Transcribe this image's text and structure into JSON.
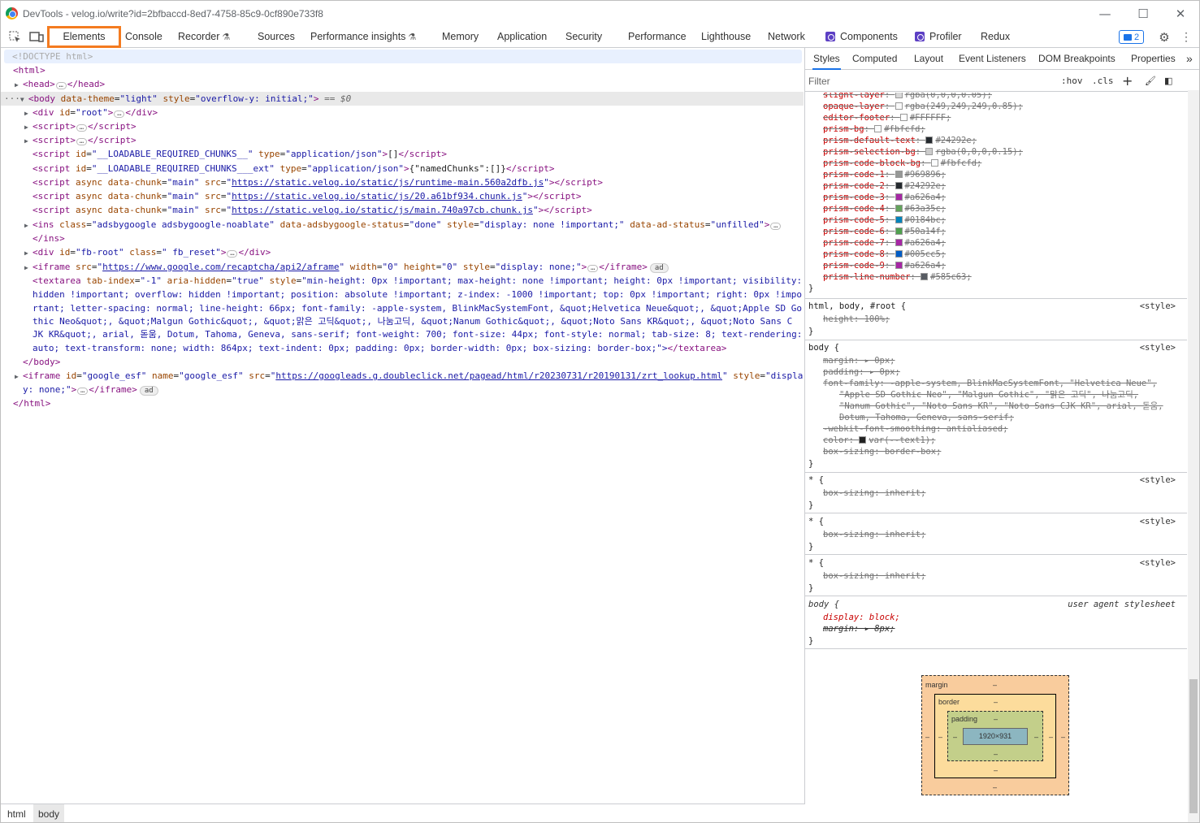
{
  "window": {
    "title": "DevTools - velog.io/write?id=2bfbaccd-8ed7-4758-85c9-0cf890e733f8",
    "minimize": "—",
    "maximize": "☐",
    "close": "✕"
  },
  "tabs": {
    "elements": "Elements",
    "console": "Console",
    "recorder": "Recorder",
    "sources": "Sources",
    "performance_insights": "Performance insights",
    "memory": "Memory",
    "application": "Application",
    "security": "Security",
    "performance": "Performance",
    "lighthouse": "Lighthouse",
    "network": "Network",
    "components": "Components",
    "profiler": "Profiler",
    "redux": "Redux",
    "issues_count": "2"
  },
  "dom": {
    "doctype": "<!DOCTYPE html>",
    "html_open": "<html>",
    "head": "head",
    "body_attrs": {
      "theme_name": "data-theme",
      "theme_val": "\"light\"",
      "style_name": "style",
      "style_val": "\"overflow-y: initial;\""
    },
    "selected_marker": "== $0",
    "root": {
      "tag": "div",
      "attr": "id",
      "val": "\"root\""
    },
    "lrc": {
      "text1": "__LOADABLE_REQUIRED_CHUNKS__",
      "json1": "[]",
      "text2": "__LOADABLE_REQUIRED_CHUNKS___ext",
      "json2": "{\"namedChunks\":[]}"
    },
    "scripts": [
      "https://static.velog.io/static/js/runtime-main.560a2dfb.js",
      "https://static.velog.io/static/js/20.a61bf934.chunk.js",
      "https://static.velog.io/static/js/main.740a97cb.chunk.js"
    ],
    "ins": {
      "class": "\"adsbygoogle adsbygoogle-noablate\"",
      "status": "\"done\"",
      "style": "\"display: none !important;\"",
      "adstatus": "\"unfilled\""
    },
    "fbroot": {
      "id": "\"fb-root\"",
      "class": "\" fb_reset\""
    },
    "recaptcha_src": "https://www.google.com/recaptcha/api2/aframe",
    "recaptcha_rest": {
      "w": "\"0\"",
      "h": "\"0\"",
      "style": "\"display: none;\""
    },
    "ad_badge": "ad",
    "textarea_lines": [
      "min-height: 0px !important; max-height: none !important; height: 0px !important; visibility:",
      "hidden !important; overflow: hidden !important; position: absolute !important; z-index: -1000 !important; top: 0px !important; right: 0px !impo",
      "rtant; letter-spacing: normal; line-height: 66px; font-family: -apple-system, BlinkMacSystemFont, &quot;Helvetica Neue&quot;, &quot;Apple SD Go",
      "thic Neo&quot;, &quot;Malgun Gothic&quot;, &quot;맑은 고딕&quot;, 나눔고딕, &quot;Nanum Gothic&quot;, &quot;Noto Sans KR&quot;, &quot;Noto Sans C",
      "JK KR&quot;, arial, 돋움, Dotum, Tahoma, Geneva, sans-serif; font-weight: 700; font-size: 44px; font-style: normal; tab-size: 8; text-rendering:",
      "auto; text-transform: none; width: 864px; text-indent: 0px; padding: 0px; border-width: 0px; box-sizing: border-box;\">"
    ],
    "esf_src": "https://googleads.g.doubleclick.net/pagead/html/r20230731/r20190131/zrt_lookup.html",
    "esf_style_part1": "\"displa",
    "esf_style_part2": "y: none;\""
  },
  "breadcrumbs": [
    "html",
    "body"
  ],
  "side_tabs": {
    "styles": "Styles",
    "computed": "Computed",
    "layout": "Layout",
    "event_listeners": "Event Listeners",
    "dom_breakpoints": "DOM Breakpoints",
    "properties": "Properties",
    "more": "»"
  },
  "filter": {
    "placeholder": "Filter",
    "hov": ":hov",
    "cls": ".cls"
  },
  "vars": [
    {
      "name": "slight-layer",
      "color": "#d9d9d9",
      "value": "rgba(0,0,0,0.05);"
    },
    {
      "name": "opaque-layer",
      "color": "#f9f9f9",
      "value": "rgba(249,249,249,0.85);"
    },
    {
      "name": "editor-footer",
      "color": "#ffffff",
      "value": "#FFFFFF;"
    },
    {
      "name": "prism-bg",
      "color": "#fbfcfd",
      "value": "#fbfcfd;"
    },
    {
      "name": "prism-default-text",
      "color": "#24292e",
      "value": "#24292e;"
    },
    {
      "name": "prism-selection-bg",
      "color": "#cccccc",
      "value": "rgba(0,0,0,0.15);"
    },
    {
      "name": "prism-code-block-bg",
      "color": "#fbfcfd",
      "value": "#fbfcfd;"
    },
    {
      "name": "prism-code-1",
      "color": "#969896",
      "value": "#969896;"
    },
    {
      "name": "prism-code-2",
      "color": "#24292e",
      "value": "#24292e;"
    },
    {
      "name": "prism-code-3",
      "color": "#a626a4",
      "value": "#a626a4;"
    },
    {
      "name": "prism-code-4",
      "color": "#63a35c",
      "value": "#63a35c;"
    },
    {
      "name": "prism-code-5",
      "color": "#0184bc",
      "value": "#0184bc;"
    },
    {
      "name": "prism-code-6",
      "color": "#50a14f",
      "value": "#50a14f;"
    },
    {
      "name": "prism-code-7",
      "color": "#a626a4",
      "value": "#a626a4;"
    },
    {
      "name": "prism-code-8",
      "color": "#005cc5",
      "value": "#005cc5;"
    },
    {
      "name": "prism-code-9",
      "color": "#a626a4",
      "value": "#a626a4;"
    },
    {
      "name": "prism-line-number",
      "color": "#585c63",
      "value": "#585c63;"
    }
  ],
  "rules": {
    "r1_selector": "html, body, #root {",
    "r1_source": "<style>",
    "r1_prop": "height: 100%;",
    "body_selector": "body {",
    "body_source": "<style>",
    "body_margin": "margin: ▸ 0px;",
    "body_padding": "padding: ▸ 0px;",
    "body_font1": "font-family: -apple-system, BlinkMacSystemFont, \"Helvetica Neue\",",
    "body_font2": "\"Apple SD Gothic Neo\", \"Malgun Gothic\", \"맑은 고딕\", 나눔고딕,",
    "body_font3": "\"Nanum Gothic\", \"Noto Sans KR\", \"Noto Sans CJK KR\", arial, 돋움,",
    "body_font4": "Dotum, Tahoma, Geneva, sans-serif;",
    "body_smooth": "-webkit-font-smoothing: antialiased;",
    "body_color_name": "color:",
    "body_color_val": "var(--text1);",
    "body_boxsizing": "box-sizing: border-box;",
    "star_selector": "* {",
    "star_source": "<style>",
    "star_prop": "box-sizing: inherit;",
    "ua_selector": "body {",
    "ua_source": "user agent stylesheet",
    "ua_display": "display: block;",
    "ua_margin": "margin: ▸ 8px;",
    "close": "}"
  },
  "box_model": {
    "margin_label": "margin",
    "border_label": "border",
    "padding_label": "padding",
    "dash": "–",
    "content_size": "1920×931"
  }
}
